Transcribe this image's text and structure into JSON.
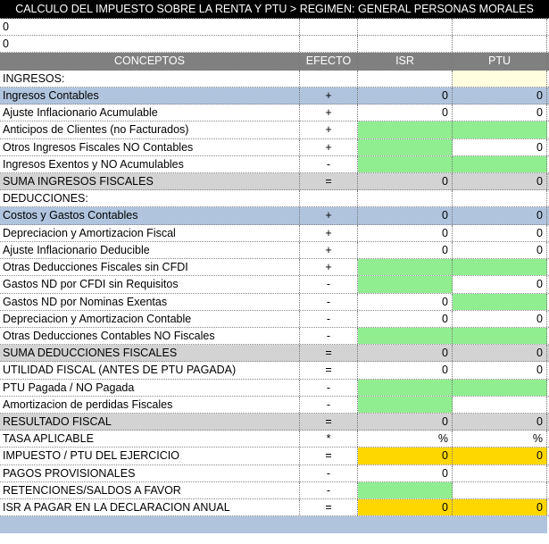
{
  "title": "CALCULO DEL IMPUESTO SOBRE LA RENTA Y PTU > REGIMEN: GENERAL PERSONAS MORALES",
  "top_values": [
    "0",
    "0"
  ],
  "headers": {
    "concepts": "CONCEPTOS",
    "efecto": "EFECTO",
    "isr": "ISR",
    "ptu": "PTU"
  },
  "colors": {
    "blue": "#b0c4de",
    "gray": "#d3d3d3",
    "green": "#90ee90",
    "yellow": "#ffd700",
    "cream": "#ffffe0",
    "header": "#808080"
  },
  "rows": [
    {
      "label": "INGRESOS:",
      "efecto": "",
      "isr": "",
      "ptu": "",
      "row": "",
      "isr_fill": "",
      "ptu_fill": "cream"
    },
    {
      "label": "Ingresos Contables",
      "efecto": "+",
      "isr": "0",
      "ptu": "0",
      "row": "blue",
      "isr_fill": "",
      "ptu_fill": ""
    },
    {
      "label": "Ajuste Inflacionario Acumulable",
      "efecto": "+",
      "isr": "0",
      "ptu": "0",
      "row": "",
      "isr_fill": "",
      "ptu_fill": ""
    },
    {
      "label": "Anticipos de Clientes (no Facturados)",
      "efecto": "+",
      "isr": "",
      "ptu": "",
      "row": "",
      "isr_fill": "green",
      "ptu_fill": "green"
    },
    {
      "label": "Otros Ingresos Fiscales NO Contables",
      "efecto": "+",
      "isr": "",
      "ptu": "0",
      "row": "",
      "isr_fill": "green",
      "ptu_fill": ""
    },
    {
      "label": "Ingresos Exentos y NO Acumulables",
      "efecto": "-",
      "isr": "",
      "ptu": "",
      "row": "",
      "isr_fill": "green",
      "ptu_fill": "green"
    },
    {
      "label": "SUMA INGRESOS FISCALES",
      "efecto": "=",
      "isr": "0",
      "ptu": "0",
      "row": "gray",
      "isr_fill": "",
      "ptu_fill": ""
    },
    {
      "label": "DEDUCCIONES:",
      "efecto": "",
      "isr": "",
      "ptu": "",
      "row": "",
      "isr_fill": "",
      "ptu_fill": ""
    },
    {
      "label": "Costos y Gastos Contables",
      "efecto": "+",
      "isr": "0",
      "ptu": "0",
      "row": "blue",
      "isr_fill": "",
      "ptu_fill": ""
    },
    {
      "label": "Depreciacion y Amortizacion Fiscal",
      "efecto": "+",
      "isr": "0",
      "ptu": "0",
      "row": "",
      "isr_fill": "",
      "ptu_fill": ""
    },
    {
      "label": "Ajuste Inflacionario Deducible",
      "efecto": "+",
      "isr": "0",
      "ptu": "0",
      "row": "",
      "isr_fill": "",
      "ptu_fill": ""
    },
    {
      "label": "Otras Deducciones Fiscales sin CFDI",
      "efecto": "+",
      "isr": "",
      "ptu": "",
      "row": "",
      "isr_fill": "green",
      "ptu_fill": "green"
    },
    {
      "label": "Gastos ND por CFDI sin Requisitos",
      "efecto": "-",
      "isr": "",
      "ptu": "0",
      "row": "",
      "isr_fill": "green",
      "ptu_fill": ""
    },
    {
      "label": "Gastos ND por Nominas Exentas",
      "efecto": "-",
      "isr": "0",
      "ptu": "",
      "row": "",
      "isr_fill": "",
      "ptu_fill": "green"
    },
    {
      "label": "Depreciacion y Amortizacion Contable",
      "efecto": "-",
      "isr": "0",
      "ptu": "0",
      "row": "",
      "isr_fill": "",
      "ptu_fill": ""
    },
    {
      "label": "Otras Deducciones Contables NO Fiscales",
      "efecto": "-",
      "isr": "",
      "ptu": "",
      "row": "",
      "isr_fill": "green",
      "ptu_fill": "green"
    },
    {
      "label": "SUMA DEDUCCIONES FISCALES",
      "efecto": "=",
      "isr": "0",
      "ptu": "0",
      "row": "gray",
      "isr_fill": "",
      "ptu_fill": ""
    },
    {
      "label": "UTILIDAD FISCAL (ANTES DE PTU PAGADA)",
      "efecto": "=",
      "isr": "0",
      "ptu": "0",
      "row": "",
      "isr_fill": "",
      "ptu_fill": ""
    },
    {
      "label": "PTU Pagada / NO Pagada",
      "efecto": "-",
      "isr": "",
      "ptu": "",
      "row": "",
      "isr_fill": "green",
      "ptu_fill": "green"
    },
    {
      "label": "Amortizacion de perdidas Fiscales",
      "efecto": "-",
      "isr": "",
      "ptu": "",
      "row": "",
      "isr_fill": "green",
      "ptu_fill": ""
    },
    {
      "label": "RESULTADO FISCAL",
      "efecto": "=",
      "isr": "0",
      "ptu": "0",
      "row": "gray",
      "isr_fill": "",
      "ptu_fill": ""
    },
    {
      "label": "TASA APLICABLE",
      "efecto": "*",
      "isr": "%",
      "ptu": "%",
      "row": "",
      "isr_fill": "",
      "ptu_fill": ""
    },
    {
      "label": "IMPUESTO / PTU DEL EJERCICIO",
      "efecto": "=",
      "isr": "0",
      "ptu": "0",
      "row": "",
      "isr_fill": "yellow",
      "ptu_fill": "yellow"
    },
    {
      "label": "PAGOS PROVISIONALES",
      "efecto": "-",
      "isr": "0",
      "ptu": "",
      "row": "",
      "isr_fill": "",
      "ptu_fill": ""
    },
    {
      "label": "RETENCIONES/SALDOS A FAVOR",
      "efecto": "-",
      "isr": "",
      "ptu": "",
      "row": "",
      "isr_fill": "green",
      "ptu_fill": ""
    },
    {
      "label": "ISR A PAGAR EN LA DECLARACION ANUAL",
      "efecto": "=",
      "isr": "0",
      "ptu": "0",
      "row": "",
      "isr_fill": "yellow",
      "ptu_fill": "yellow"
    }
  ]
}
